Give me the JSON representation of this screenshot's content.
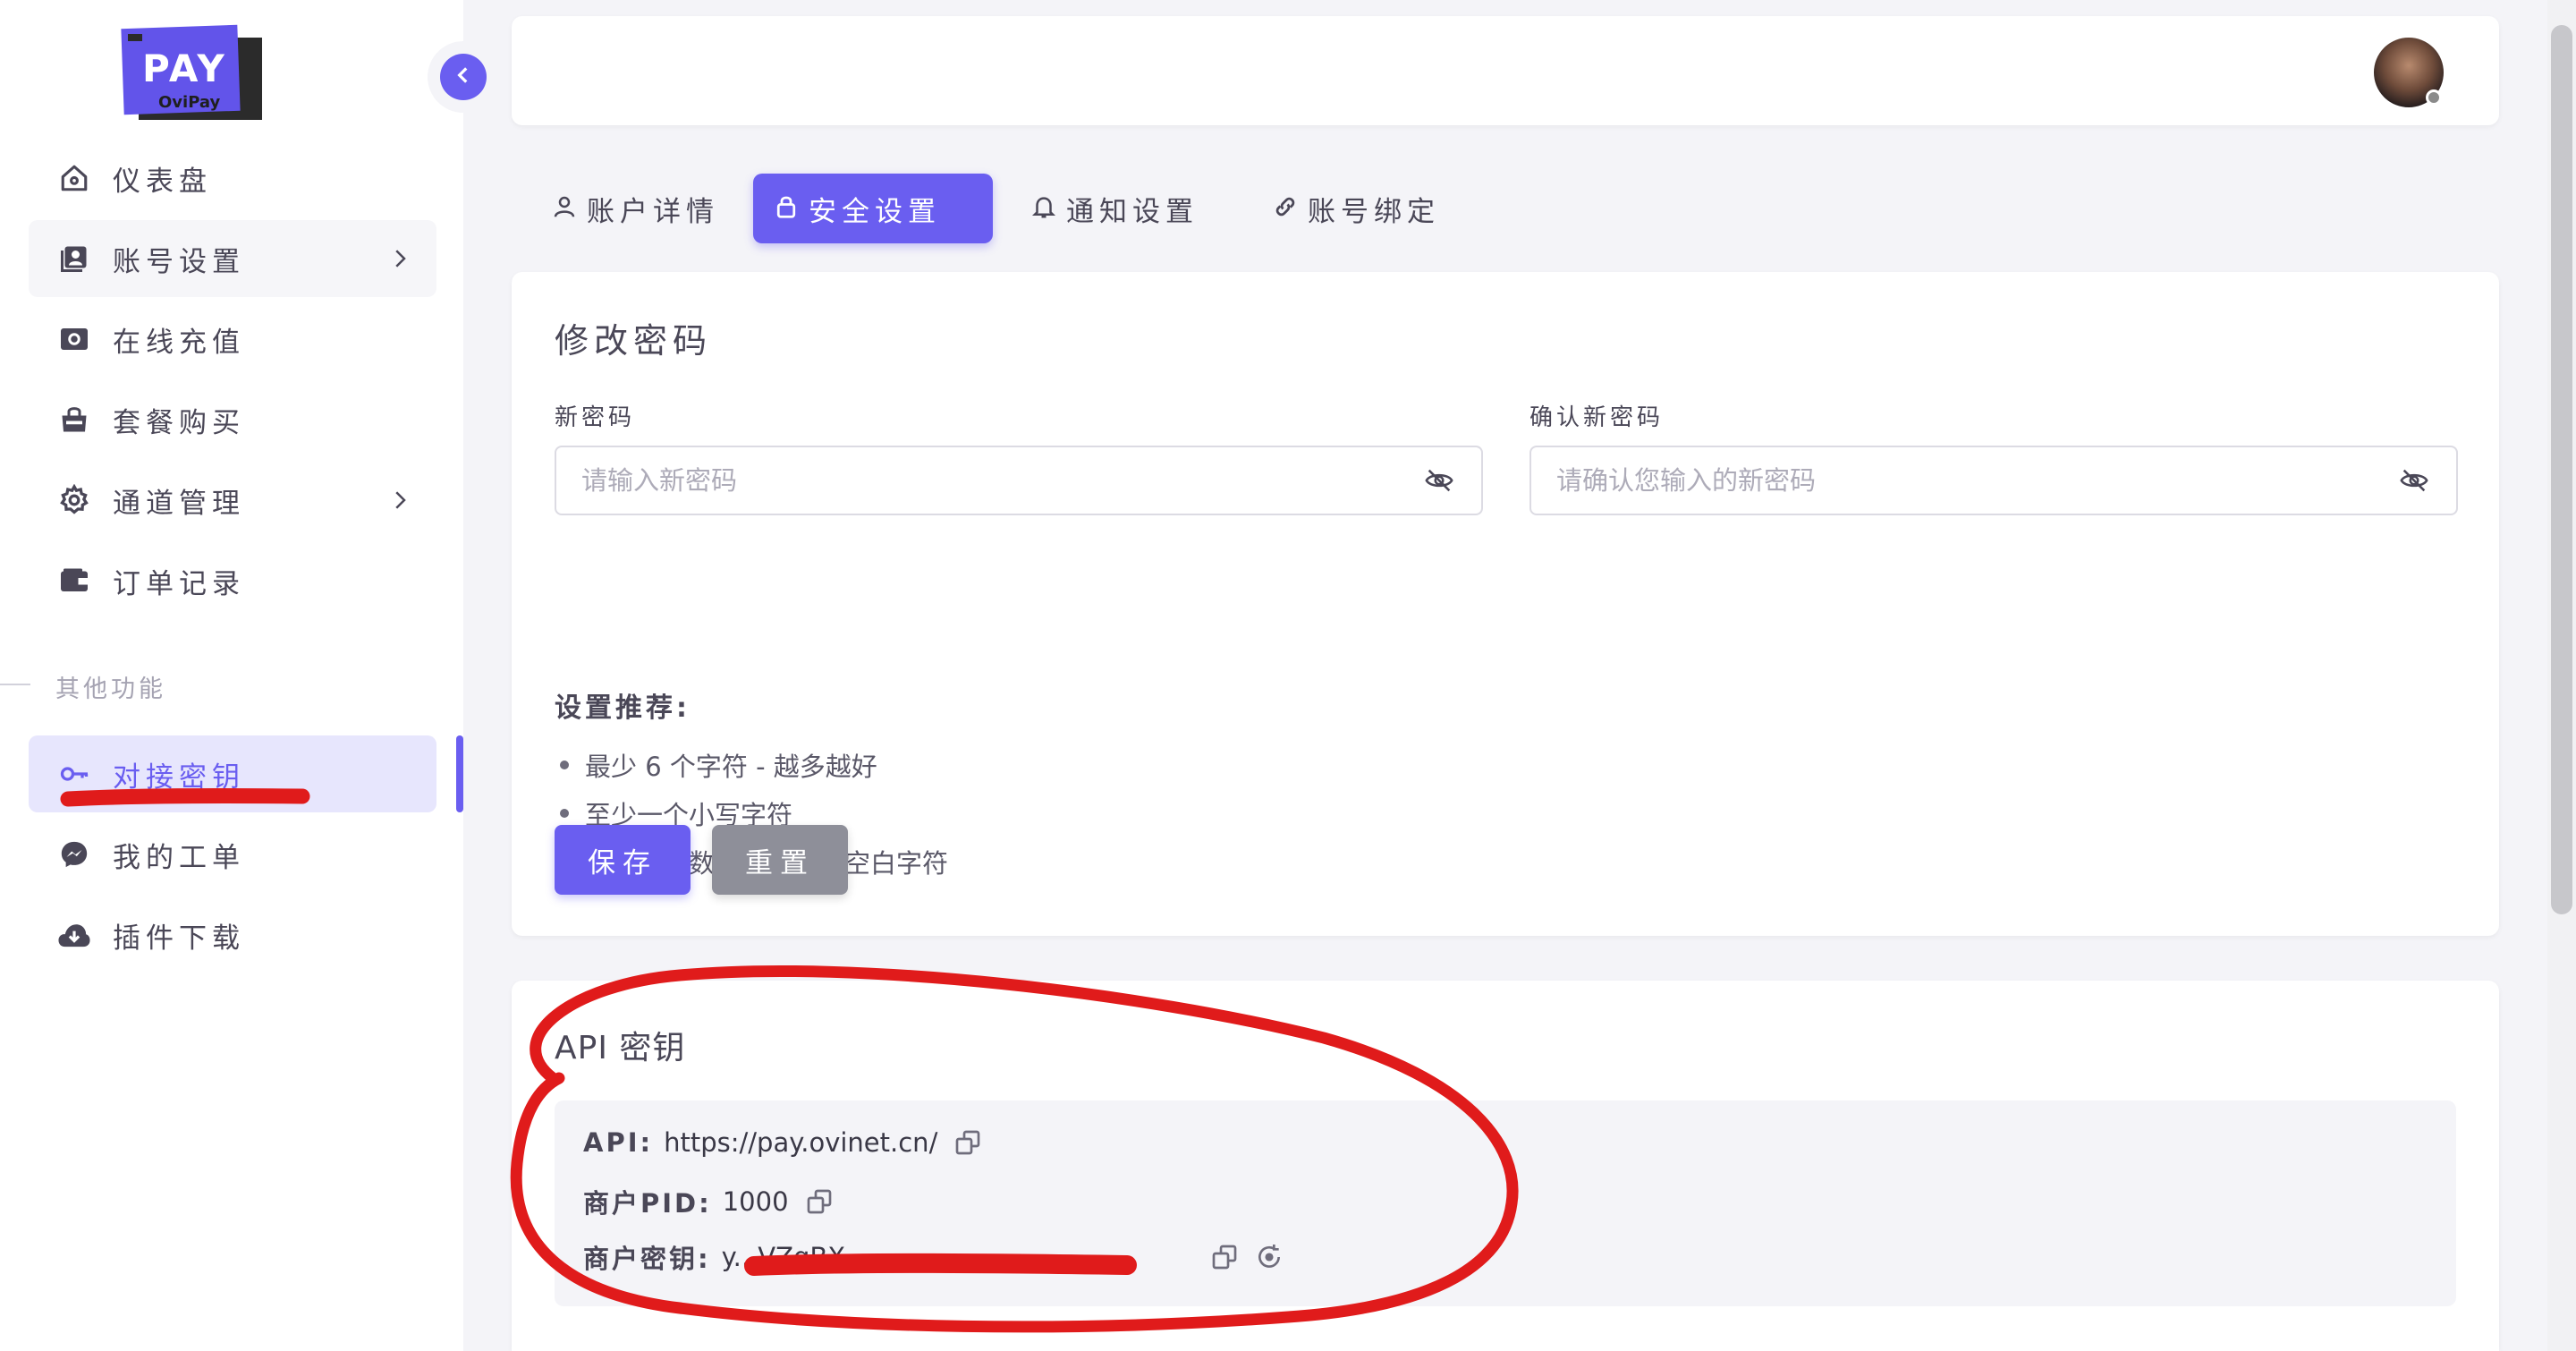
{
  "brand": {
    "logo_text": "PAY",
    "logo_sub": "OviPay"
  },
  "sidebar": {
    "items": [
      {
        "label": "仪表盘",
        "icon": "home-icon"
      },
      {
        "label": "账号设置",
        "icon": "user-badge-icon"
      },
      {
        "label": "在线充值",
        "icon": "camera-icon"
      },
      {
        "label": "套餐购买",
        "icon": "shopping-bag-icon"
      },
      {
        "label": "通道管理",
        "icon": "gear-icon"
      },
      {
        "label": "订单记录",
        "icon": "wallet-icon"
      }
    ],
    "section_label": "其他功能",
    "other_items": [
      {
        "label": "对接密钥",
        "icon": "key-icon"
      },
      {
        "label": "我的工单",
        "icon": "messenger-icon"
      },
      {
        "label": "插件下载",
        "icon": "cloud-download-icon"
      }
    ]
  },
  "tabs": [
    {
      "label": "账户详情",
      "icon": "user-icon"
    },
    {
      "label": "安全设置",
      "icon": "lock-icon"
    },
    {
      "label": "通知设置",
      "icon": "bell-icon"
    },
    {
      "label": "账号绑定",
      "icon": "link-icon"
    }
  ],
  "password": {
    "title": "修改密码",
    "new_label": "新密码",
    "new_placeholder": "请输入新密码",
    "confirm_label": "确认新密码",
    "confirm_placeholder": "请确认您输入的新密码",
    "rec_title": "设置推荐:",
    "recommendations": [
      "最少 6 个字符 - 越多越好",
      "至少一个小写字符",
      "至少一个数字、符号或空白字符"
    ],
    "save_label": "保存",
    "reset_label": "重置"
  },
  "api": {
    "title": "API 密钥",
    "api_key": "API:",
    "api_value": "https://pay.ovinet.cn/",
    "pid_key": "商户PID:",
    "pid_value": "1000",
    "secret_key": "商户密钥:",
    "secret_value": "y...VZqBX"
  },
  "colors": {
    "accent": "#6a5ef0",
    "annotation": "#e01b1b"
  }
}
